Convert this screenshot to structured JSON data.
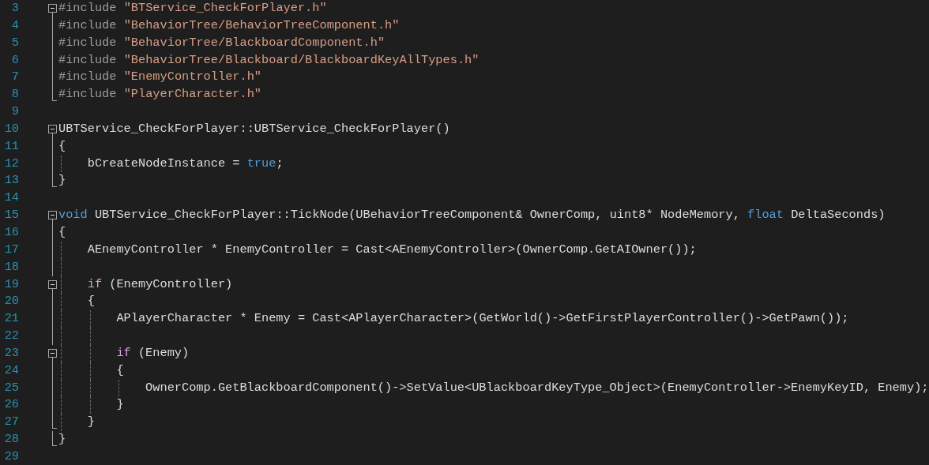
{
  "editor": {
    "lines": [
      {
        "number": "3",
        "kind": "fold_start",
        "tokens": [
          {
            "kind": "directive",
            "text": "#include "
          },
          {
            "kind": "string",
            "text": "\"BTService_CheckForPlayer.h\""
          }
        ]
      },
      {
        "number": "4",
        "kind": "fold_line",
        "tokens": [
          {
            "kind": "directive",
            "text": "#include "
          },
          {
            "kind": "string",
            "text": "\"BehaviorTree/BehaviorTreeComponent.h\""
          }
        ]
      },
      {
        "number": "5",
        "kind": "fold_line",
        "tokens": [
          {
            "kind": "directive",
            "text": "#include "
          },
          {
            "kind": "string",
            "text": "\"BehaviorTree/BlackboardComponent.h\""
          }
        ]
      },
      {
        "number": "6",
        "kind": "fold_line",
        "tokens": [
          {
            "kind": "directive",
            "text": "#include "
          },
          {
            "kind": "string",
            "text": "\"BehaviorTree/Blackboard/BlackboardKeyAllTypes.h\""
          }
        ]
      },
      {
        "number": "7",
        "kind": "fold_line",
        "tokens": [
          {
            "kind": "directive",
            "text": "#include "
          },
          {
            "kind": "string",
            "text": "\"EnemyController.h\""
          }
        ]
      },
      {
        "number": "8",
        "kind": "fold_end",
        "tokens": [
          {
            "kind": "directive",
            "text": "#include "
          },
          {
            "kind": "string",
            "text": "\"PlayerCharacter.h\""
          }
        ]
      },
      {
        "number": "9",
        "kind": "plain"
      },
      {
        "number": "10",
        "kind": "fold_start",
        "tokens": [
          {
            "kind": "plain",
            "text": "UBTService_CheckForPlayer::UBTService_CheckForPlayer()"
          }
        ]
      },
      {
        "number": "11",
        "kind": "fold_line",
        "tokens": [
          {
            "kind": "plain",
            "text": "{"
          }
        ]
      },
      {
        "number": "12",
        "kind": "fold_line",
        "tokens": [
          {
            "kind": "plain",
            "text": "    bCreateNodeInstance = "
          },
          {
            "kind": "keyword",
            "text": "true"
          },
          {
            "kind": "plain",
            "text": ";"
          }
        ]
      },
      {
        "number": "13",
        "kind": "fold_end",
        "tokens": [
          {
            "kind": "plain",
            "text": "}"
          }
        ]
      },
      {
        "number": "14",
        "kind": "plain"
      },
      {
        "number": "15",
        "kind": "fold_start",
        "tokens": [
          {
            "kind": "keyword",
            "text": "void"
          },
          {
            "kind": "plain",
            "text": " UBTService_CheckForPlayer::TickNode(UBehaviorTreeComponent& OwnerComp, uint8* NodeMemory, "
          },
          {
            "kind": "keyword",
            "text": "float"
          },
          {
            "kind": "plain",
            "text": " DeltaSeconds)"
          }
        ]
      },
      {
        "number": "16",
        "kind": "fold_line",
        "tokens": [
          {
            "kind": "plain",
            "text": "{"
          }
        ]
      },
      {
        "number": "17",
        "kind": "fold_line",
        "tokens": [
          {
            "kind": "plain",
            "text": "    AEnemyController * EnemyController = Cast<AEnemyController>(OwnerComp.GetAIOwner());"
          }
        ]
      },
      {
        "number": "18",
        "kind": "fold_line"
      },
      {
        "number": "19",
        "kind": "fold_start",
        "tokens": [
          {
            "kind": "control",
            "text": "    if"
          },
          {
            "kind": "plain",
            "text": " (EnemyController)"
          }
        ]
      },
      {
        "number": "20",
        "kind": "fold_line",
        "tokens": [
          {
            "kind": "plain",
            "text": "    {"
          }
        ]
      },
      {
        "number": "21",
        "kind": "fold_line",
        "tokens": [
          {
            "kind": "plain",
            "text": "        APlayerCharacter * Enemy = Cast<APlayerCharacter>(GetWorld()->GetFirstPlayerController()->GetPawn());"
          }
        ]
      },
      {
        "number": "22",
        "kind": "fold_line"
      },
      {
        "number": "23",
        "kind": "fold_start",
        "tokens": [
          {
            "kind": "control",
            "text": "        if"
          },
          {
            "kind": "plain",
            "text": " (Enemy)"
          }
        ]
      },
      {
        "number": "24",
        "kind": "fold_line",
        "tokens": [
          {
            "kind": "plain",
            "text": "        {"
          }
        ]
      },
      {
        "number": "25",
        "kind": "fold_line",
        "tokens": [
          {
            "kind": "plain",
            "text": "            OwnerComp.GetBlackboardComponent()->SetValue<UBlackboardKeyType_Object>(EnemyController->EnemyKeyID, Enemy);"
          }
        ]
      },
      {
        "number": "26",
        "kind": "fold_line",
        "tokens": [
          {
            "kind": "plain",
            "text": "        }"
          }
        ]
      },
      {
        "number": "27",
        "kind": "fold_end",
        "tokens": [
          {
            "kind": "plain",
            "text": "    }"
          }
        ]
      },
      {
        "number": "28",
        "kind": "fold_end",
        "tokens": [
          {
            "kind": "plain",
            "text": "}"
          }
        ]
      },
      {
        "number": "29",
        "kind": "plain"
      }
    ]
  }
}
